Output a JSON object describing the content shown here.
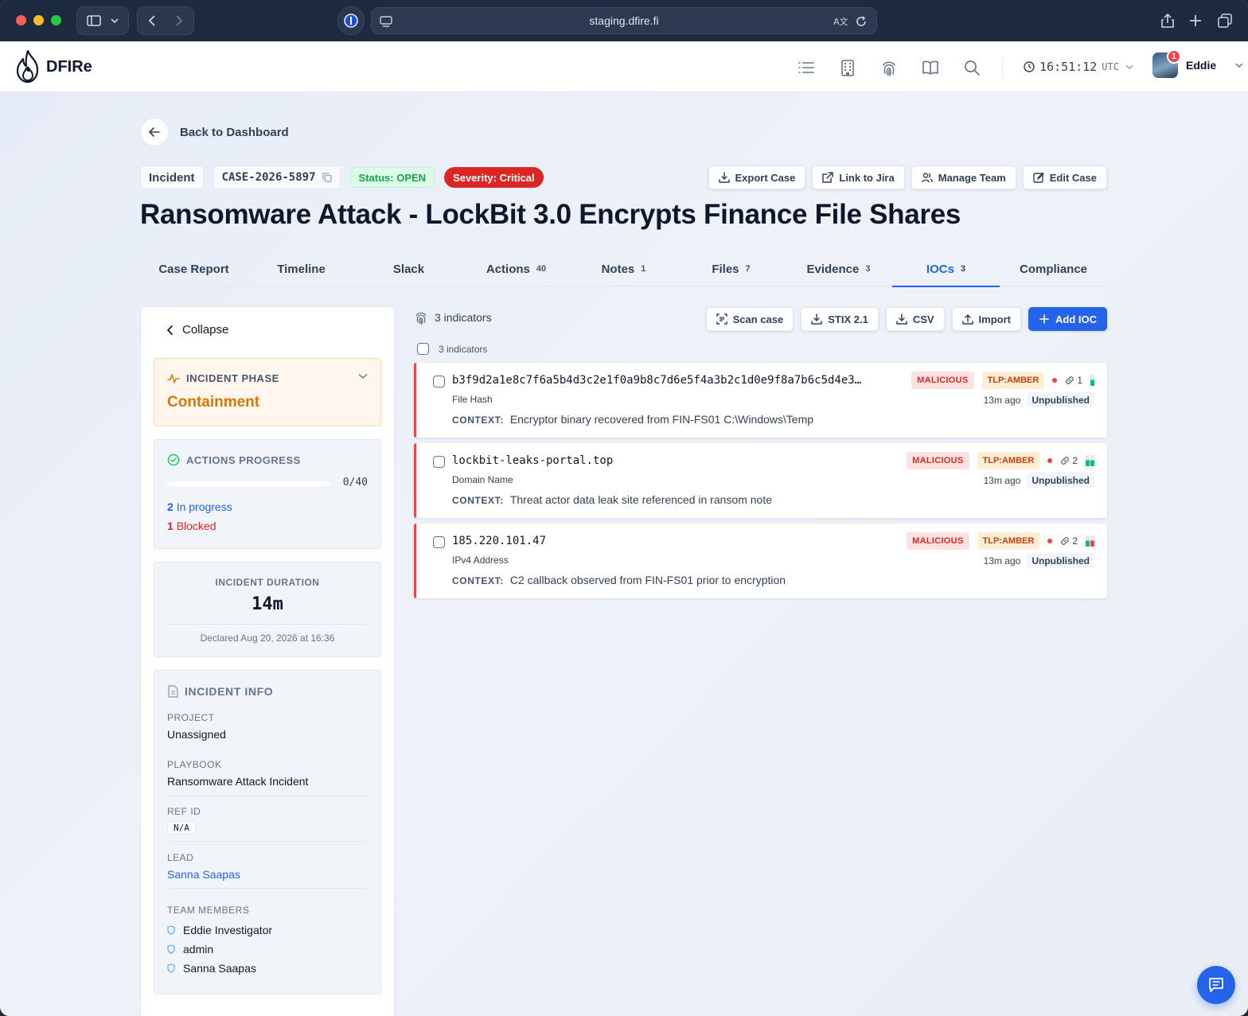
{
  "browser": {
    "url": "staging.dfire.fi"
  },
  "app": {
    "brand": "DFIRe",
    "clock_time": "16:51:12",
    "clock_tz": "UTC",
    "user_name": "Eddie",
    "notification_count": "1"
  },
  "nav": {
    "back_label": "Back to Dashboard"
  },
  "case": {
    "type": "Incident",
    "id": "CASE-2026-5897",
    "status": "Status: OPEN",
    "severity": "Severity: Critical",
    "title": "Ransomware Attack - LockBit 3.0 Encrypts Finance File Shares"
  },
  "case_actions": {
    "export": "Export Case",
    "jira": "Link to Jira",
    "team": "Manage Team",
    "edit": "Edit Case"
  },
  "tabs": [
    {
      "label": "Case Report",
      "count": ""
    },
    {
      "label": "Timeline",
      "count": ""
    },
    {
      "label": "Slack",
      "count": ""
    },
    {
      "label": "Actions",
      "count": "40"
    },
    {
      "label": "Notes",
      "count": "1"
    },
    {
      "label": "Files",
      "count": "7"
    },
    {
      "label": "Evidence",
      "count": "3"
    },
    {
      "label": "IOCs",
      "count": "3"
    },
    {
      "label": "Compliance",
      "count": ""
    }
  ],
  "active_tab": "IOCs",
  "sidebar": {
    "collapse_label": "Collapse",
    "phase": {
      "label": "INCIDENT PHASE",
      "value": "Containment"
    },
    "progress": {
      "label": "ACTIONS PROGRESS",
      "value": "0/40",
      "fraction": 0.0,
      "in_progress_count": "2",
      "in_progress_label": "In progress",
      "blocked_count": "1",
      "blocked_label": "Blocked"
    },
    "duration": {
      "label": "INCIDENT DURATION",
      "value": "14m",
      "declared": "Declared Aug 20, 2026 at 16:36"
    },
    "info": {
      "label": "INCIDENT INFO",
      "project_label": "PROJECT",
      "project_value": "Unassigned",
      "playbook_label": "PLAYBOOK",
      "playbook_value": "Ransomware Attack Incident",
      "refid_label": "REF ID",
      "refid_value": "N/A",
      "lead_label": "LEAD",
      "lead_value": "Sanna Saapas",
      "team_label": "TEAM MEMBERS",
      "members": [
        "Eddie Investigator",
        "admin",
        "Sanna Saapas"
      ]
    }
  },
  "iocs": {
    "count_label": "3 indicators",
    "select_all_label": "3 indicators",
    "tools": {
      "scan": "Scan case",
      "stix": "STIX 2.1",
      "csv": "CSV",
      "import": "Import",
      "add": "Add IOC"
    },
    "context_label": "CONTEXT:",
    "items": [
      {
        "value": "b3f9d2a1e8c7f6a5b4d3c2e1f0a9b8c7d6e5f4a3b2c1d0e9f8a7b6c5d4e3…",
        "type": "File Hash",
        "verdict": "MALICIOUS",
        "tlp": "TLP:AMBER",
        "links": "1",
        "age": "13m ago",
        "published": "Unpublished",
        "context": "Encryptor binary recovered from FIN-FS01 C:\\Windows\\Temp",
        "bar_colors": [
          "#10b981"
        ]
      },
      {
        "value": "lockbit-leaks-portal.top",
        "type": "Domain Name",
        "verdict": "MALICIOUS",
        "tlp": "TLP:AMBER",
        "links": "2",
        "age": "13m ago",
        "published": "Unpublished",
        "context": "Threat actor data leak site referenced in ransom note",
        "bar_colors": [
          "#10b981",
          "#10b981"
        ]
      },
      {
        "value": "185.220.101.47",
        "type": "IPv4 Address",
        "verdict": "MALICIOUS",
        "tlp": "TLP:AMBER",
        "links": "2",
        "age": "13m ago",
        "published": "Unpublished",
        "context": "C2 callback observed from FIN-FS01 prior to encryption",
        "bar_colors": [
          "#10b981",
          "#ef4444"
        ]
      }
    ]
  }
}
